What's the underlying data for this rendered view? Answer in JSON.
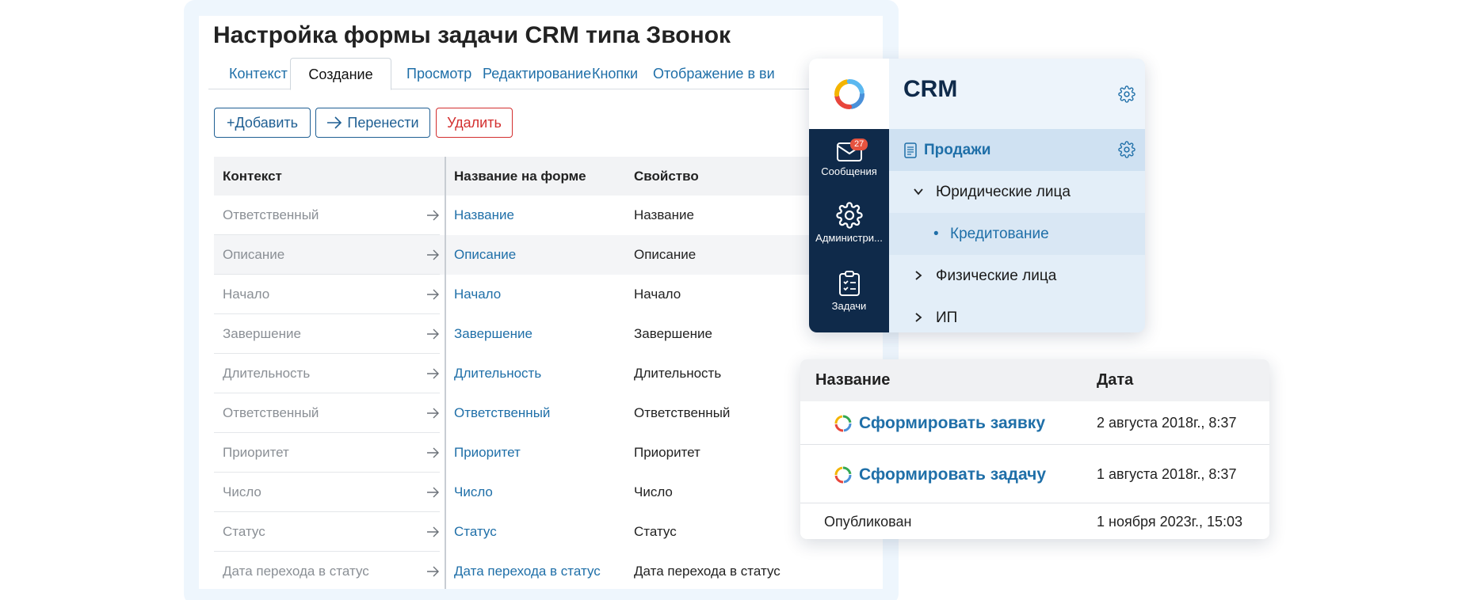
{
  "form": {
    "title": "Настройка формы задачи CRM типа Звонок",
    "tabs": [
      {
        "label": "Контекст"
      },
      {
        "label": "Создание",
        "active": true
      },
      {
        "label": "Просмотр"
      },
      {
        "label": "Редактирование"
      },
      {
        "label": "Кнопки"
      },
      {
        "label": "Отображение в ви"
      }
    ],
    "buttons": {
      "add": "+Добавить",
      "move": "Перенести",
      "delete": "Удалить"
    },
    "table": {
      "headers": {
        "context": "Контекст",
        "form_name": "Название на форме",
        "property": "Свойство"
      },
      "rows": [
        {
          "context": "Ответственный",
          "form_name": "Название",
          "property": "Название"
        },
        {
          "context": "Описание",
          "form_name": "Описание",
          "property": "Описание"
        },
        {
          "context": "Начало",
          "form_name": "Начало",
          "property": "Начало"
        },
        {
          "context": "Завершение",
          "form_name": "Завершение",
          "property": "Завершение"
        },
        {
          "context": "Длительность",
          "form_name": "Длительность",
          "property": "Длительность"
        },
        {
          "context": "Ответственный",
          "form_name": "Ответственный",
          "property": "Ответственный"
        },
        {
          "context": "Приоритет",
          "form_name": "Приоритет",
          "property": "Приоритет"
        },
        {
          "context": "Число",
          "form_name": "Число",
          "property": "Число"
        },
        {
          "context": "Статус",
          "form_name": "Статус",
          "property": "Статус"
        },
        {
          "context": "Дата перехода в статус",
          "form_name": "Дата перехода в статус",
          "property": "Дата перехода в статус"
        }
      ]
    }
  },
  "crm": {
    "title": "CRM",
    "nav": {
      "messages": {
        "label": "Сообщения",
        "badge": "27"
      },
      "admin": {
        "label": "Администри..."
      },
      "tasks": {
        "label": "Задачи"
      }
    },
    "tree": [
      {
        "label": "Продажи",
        "level": 0,
        "icon": "document-icon",
        "selected": true
      },
      {
        "label": "Юридические лица",
        "level": 1,
        "expanded": true
      },
      {
        "label": "Кредитование",
        "level": 2,
        "bullet": "•",
        "selected": true
      },
      {
        "label": "Физические лица",
        "level": 1,
        "expanded": false
      },
      {
        "label": "ИП",
        "level": 1,
        "expanded": false
      }
    ]
  },
  "records": {
    "headers": {
      "name": "Название",
      "date": "Дата"
    },
    "rows": [
      {
        "name": "Сформировать заявку",
        "date": "2 августа 2018г., 8:37"
      },
      {
        "name": "Сформировать задачу",
        "date": "1 августа 2018г., 8:37"
      },
      {
        "name": "Опубликован",
        "date": "1 ноября 2023г., 15:03"
      }
    ]
  },
  "colors": {
    "link_blue": "#1f6fa8",
    "dark_navy": "#0f2a4a",
    "danger_red": "#d32f2f",
    "badge_red": "#e5533f",
    "panel_tint": "#eef6fd"
  }
}
